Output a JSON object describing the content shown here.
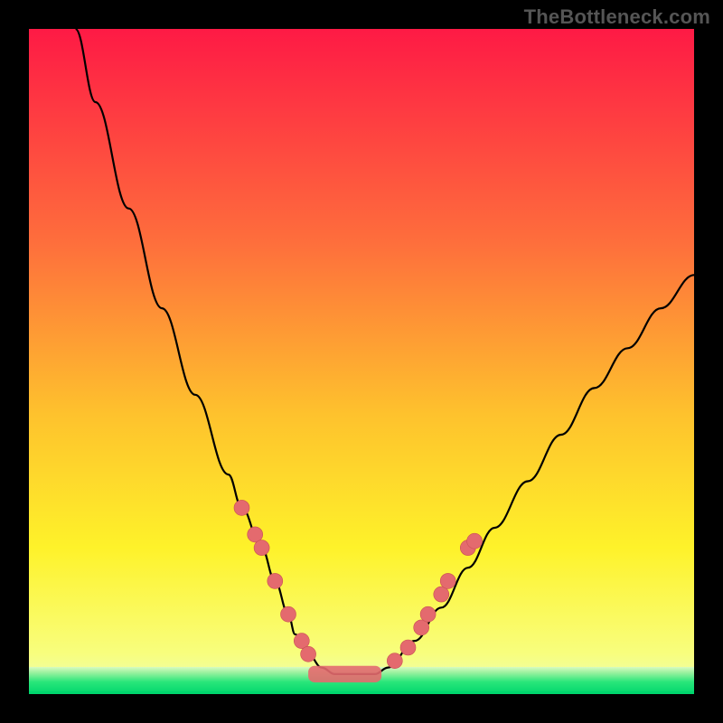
{
  "attribution": "TheBottleneck.com",
  "colors": {
    "bg_top": "#fe1a45",
    "bg_mid1": "#fe6e3c",
    "bg_mid2": "#fec22d",
    "bg_mid3": "#fef22a",
    "bg_low": "#f8fe7e",
    "green_edge": "#29e67a",
    "green_core": "#00d66d",
    "marker": "#e46a6e",
    "curve": "#000000"
  },
  "chart_data": {
    "type": "line",
    "title": "",
    "xlabel": "",
    "ylabel": "",
    "x_range": [
      0,
      100
    ],
    "y_range": [
      0,
      100
    ],
    "note": "Axes have no tick labels; values are relative (0–100) estimated from pixel positions inside the 736×736 plot area. y=0 is the bottom green line, y=100 is the top of the gradient.",
    "series": [
      {
        "name": "bottleneck-curve",
        "x": [
          7,
          10,
          15,
          20,
          25,
          30,
          32,
          35,
          37,
          39,
          40,
          42,
          44,
          46,
          48,
          50,
          52,
          54,
          58,
          62,
          66,
          70,
          75,
          80,
          85,
          90,
          95,
          100
        ],
        "y": [
          100,
          89,
          73,
          58,
          45,
          33,
          28,
          22,
          17,
          12,
          9,
          6,
          4,
          3,
          3,
          3,
          3,
          4,
          8,
          13,
          19,
          25,
          32,
          39,
          46,
          52,
          58,
          63
        ]
      }
    ],
    "markers": {
      "name": "highlighted-points",
      "color_ref": "marker",
      "points": [
        {
          "x": 32,
          "y": 28
        },
        {
          "x": 34,
          "y": 24
        },
        {
          "x": 35,
          "y": 22
        },
        {
          "x": 37,
          "y": 17
        },
        {
          "x": 39,
          "y": 12
        },
        {
          "x": 41,
          "y": 8
        },
        {
          "x": 42,
          "y": 6
        },
        {
          "x": 55,
          "y": 5
        },
        {
          "x": 57,
          "y": 7
        },
        {
          "x": 59,
          "y": 10
        },
        {
          "x": 60,
          "y": 12
        },
        {
          "x": 62,
          "y": 15
        },
        {
          "x": 63,
          "y": 17
        },
        {
          "x": 66,
          "y": 22
        },
        {
          "x": 67,
          "y": 23
        }
      ]
    },
    "bottom_band": {
      "name": "flat-minimum-band",
      "x_start": 42,
      "x_end": 53,
      "y": 3,
      "thickness": 2.5
    },
    "green_baseline_y": 0
  }
}
